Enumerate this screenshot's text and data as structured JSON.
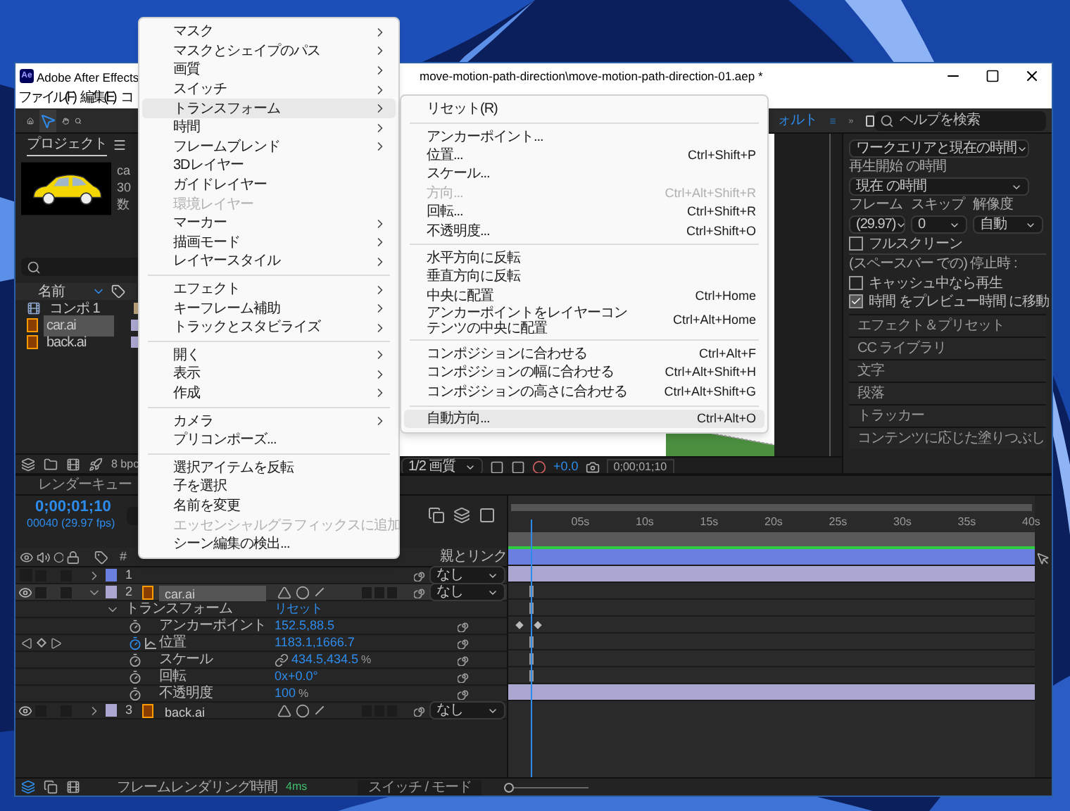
{
  "window": {
    "app_icon": "Ae",
    "title_parts": [
      "Adobe After Effects",
      "move-motion-path-direction\\move-motion-path-direction-01.aep *"
    ]
  },
  "menubar": [
    "ファイル(F)",
    "編集(E)",
    "コ"
  ],
  "toolbar": {
    "workspace": "ォルト",
    "search": {
      "placeholder": "ヘルプを検索"
    }
  },
  "project": {
    "title": "プロジェクト",
    "info": [
      "ca",
      "30",
      "数"
    ],
    "column": "名前",
    "bit_depth": "8 bpc",
    "items": [
      {
        "name": "コンポ 1",
        "kind": "comp",
        "color": "#b8a07a",
        "selected": false
      },
      {
        "name": "car.ai",
        "kind": "ai",
        "color": "#aaa7d0",
        "selected": true
      },
      {
        "name": "back.ai",
        "kind": "ai",
        "color": "#aaa7d0",
        "selected": false
      }
    ]
  },
  "viewer": {
    "quality": "1/2 画質",
    "exposure": "+0.0",
    "timecode": "0;00;01;10"
  },
  "preview": {
    "range": "ワークエリアと現在の時間",
    "start_label": "再生開始 の時間",
    "start": "現在 の時間",
    "frame_label": "フレーム",
    "skip_label": "スキップ",
    "resolution_label": "解像度",
    "frame": "(29.97)",
    "skip": "0",
    "resolution": "自動",
    "fullscreen": {
      "label": "フルスクリーン",
      "checked": false
    },
    "stop_label": "(スペースバー での) 停止時 :",
    "stop_checks": [
      {
        "label": "キャッシュ中なら再生",
        "checked": false
      },
      {
        "label": "時間 をプレビュー時間 に移動",
        "checked": true
      }
    ]
  },
  "panels": [
    "エフェクト＆プリセット",
    "CC ライブラリ",
    "文字",
    "段落",
    "トラッカー",
    "コンテンツに応じた塗りつぶし"
  ],
  "timeline": {
    "tab": "レンダーキュー",
    "time": "0;00;01;10",
    "frames": "00040 (29.97 fps)",
    "columns": [
      "#",
      "親とリンク"
    ],
    "ruler": [
      "05s",
      "10s",
      "15s",
      "20s",
      "25s",
      "30s",
      "35s",
      "40s"
    ],
    "layers": [
      {
        "number": "1",
        "color": "#6b7fe0",
        "visible": false,
        "expanded": false,
        "selected": false,
        "parent": "なし"
      },
      {
        "number": "2",
        "name": "car.ai",
        "color": "#aaa7d0",
        "visible": true,
        "expanded": true,
        "selected": true,
        "parent": "なし",
        "children": [
          {
            "name": "トランスフォーム",
            "value": "リセット",
            "children": [
              {
                "name": "アンカーポイント",
                "value": "152.5,88.5",
                "keyframed": false
              },
              {
                "name": "位置",
                "value": "1183.1,1666.7",
                "keyframed": true
              },
              {
                "name": "スケール",
                "value": "434.5,434.5",
                "unit": "%",
                "keyframed": false
              },
              {
                "name": "回転",
                "value": "0x+0.0°",
                "keyframed": false
              },
              {
                "name": "不透明度",
                "value": "100",
                "unit": "%",
                "keyframed": false
              }
            ]
          }
        ]
      },
      {
        "number": "3",
        "name": "back.ai",
        "color": "#aaa7d0",
        "visible": true,
        "expanded": false,
        "selected": false,
        "parent": "なし"
      }
    ],
    "zoom_slider": {
      "level": 0
    },
    "footer": {
      "render_label": "フレームレンダリング時間",
      "render_time": "4ms",
      "toggle": "スイッチ / モード"
    }
  },
  "context_menu": [
    {
      "kind": "item",
      "label": "マスク",
      "submenu": true,
      "disabled": false,
      "selected": false
    },
    {
      "kind": "item",
      "label": "マスクとシェイプのパス",
      "submenu": true,
      "disabled": false,
      "selected": false
    },
    {
      "kind": "item",
      "label": "画質",
      "submenu": true,
      "disabled": false,
      "selected": false
    },
    {
      "kind": "item",
      "label": "スイッチ",
      "submenu": true,
      "disabled": false,
      "selected": false
    },
    {
      "kind": "item",
      "label": "トランスフォーム",
      "submenu": true,
      "disabled": false,
      "selected": true
    },
    {
      "kind": "item",
      "label": "時間",
      "submenu": true,
      "disabled": false,
      "selected": false
    },
    {
      "kind": "item",
      "label": "フレームブレンド",
      "submenu": true,
      "disabled": false,
      "selected": false
    },
    {
      "kind": "item",
      "label": "3Dレイヤー",
      "submenu": false,
      "disabled": false,
      "selected": false
    },
    {
      "kind": "item",
      "label": "ガイドレイヤー",
      "submenu": false,
      "disabled": false,
      "selected": false
    },
    {
      "kind": "item",
      "label": "環境レイヤー",
      "submenu": false,
      "disabled": true,
      "selected": false
    },
    {
      "kind": "item",
      "label": "マーカー",
      "submenu": true,
      "disabled": false,
      "selected": false
    },
    {
      "kind": "item",
      "label": "描画モード",
      "submenu": true,
      "disabled": false,
      "selected": false
    },
    {
      "kind": "item",
      "label": "レイヤースタイル",
      "submenu": true,
      "disabled": false,
      "selected": false
    },
    {
      "kind": "separator"
    },
    {
      "kind": "item",
      "label": "エフェクト",
      "submenu": true,
      "disabled": false,
      "selected": false
    },
    {
      "kind": "item",
      "label": "キーフレーム補助",
      "submenu": true,
      "disabled": false,
      "selected": false
    },
    {
      "kind": "item",
      "label": "トラックとスタビライズ",
      "submenu": true,
      "disabled": false,
      "selected": false
    },
    {
      "kind": "separator"
    },
    {
      "kind": "item",
      "label": "開く",
      "submenu": true,
      "disabled": false,
      "selected": false
    },
    {
      "kind": "item",
      "label": "表示",
      "submenu": true,
      "disabled": false,
      "selected": false
    },
    {
      "kind": "item",
      "label": "作成",
      "submenu": true,
      "disabled": false,
      "selected": false
    },
    {
      "kind": "separator"
    },
    {
      "kind": "item",
      "label": "カメラ",
      "submenu": true,
      "disabled": false,
      "selected": false
    },
    {
      "kind": "item",
      "label": "プリコンポーズ...",
      "submenu": false,
      "disabled": false,
      "selected": false
    },
    {
      "kind": "separator"
    },
    {
      "kind": "item",
      "label": "選択アイテムを反転",
      "submenu": false,
      "disabled": false,
      "selected": false
    },
    {
      "kind": "item",
      "label": "子を選択",
      "submenu": false,
      "disabled": false,
      "selected": false
    },
    {
      "kind": "item",
      "label": "名前を変更",
      "submenu": false,
      "disabled": false,
      "selected": false
    },
    {
      "kind": "item",
      "label": "エッセンシャルグラフィックスに追加",
      "submenu": false,
      "disabled": true,
      "selected": false
    },
    {
      "kind": "item",
      "label": "シーン編集の検出...",
      "submenu": false,
      "disabled": false,
      "selected": false
    }
  ],
  "submenu": [
    {
      "kind": "item",
      "label": "リセット(R)",
      "disabled": false,
      "selected": false
    },
    {
      "kind": "separator"
    },
    {
      "kind": "item",
      "label": "アンカーポイント...",
      "disabled": false,
      "selected": false
    },
    {
      "kind": "item",
      "label": "位置...",
      "shortcut": "Ctrl+Shift+P",
      "disabled": false,
      "selected": false
    },
    {
      "kind": "item",
      "label": "スケール...",
      "disabled": false,
      "selected": false
    },
    {
      "kind": "item",
      "label": "方向...",
      "shortcut": "Ctrl+Alt+Shift+R",
      "disabled": true,
      "selected": false
    },
    {
      "kind": "item",
      "label": "回転...",
      "shortcut": "Ctrl+Shift+R",
      "disabled": false,
      "selected": false
    },
    {
      "kind": "item",
      "label": "不透明度...",
      "shortcut": "Ctrl+Shift+O",
      "disabled": false,
      "selected": false
    },
    {
      "kind": "separator"
    },
    {
      "kind": "item",
      "label": "水平方向に反転",
      "disabled": false,
      "selected": false
    },
    {
      "kind": "item",
      "label": "垂直方向に反転",
      "disabled": false,
      "selected": false
    },
    {
      "kind": "item",
      "label": "中央に配置",
      "shortcut": "Ctrl+Home",
      "disabled": false,
      "selected": false
    },
    {
      "kind": "item",
      "label": "アンカーポイントをレイヤーコンテンツの中央に配置",
      "shortcut": "Ctrl+Alt+Home",
      "disabled": false,
      "selected": false
    },
    {
      "kind": "separator"
    },
    {
      "kind": "item",
      "label": "コンポジションに合わせる",
      "shortcut": "Ctrl+Alt+F",
      "disabled": false,
      "selected": false
    },
    {
      "kind": "item",
      "label": "コンポジションの幅に合わせる",
      "shortcut": "Ctrl+Alt+Shift+H",
      "disabled": false,
      "selected": false
    },
    {
      "kind": "item",
      "label": "コンポジションの高さに合わせる",
      "shortcut": "Ctrl+Alt+Shift+G",
      "disabled": false,
      "selected": false
    },
    {
      "kind": "separator"
    },
    {
      "kind": "item",
      "label": "自動方向...",
      "shortcut": "Ctrl+Alt+O",
      "disabled": false,
      "selected": true
    }
  ]
}
